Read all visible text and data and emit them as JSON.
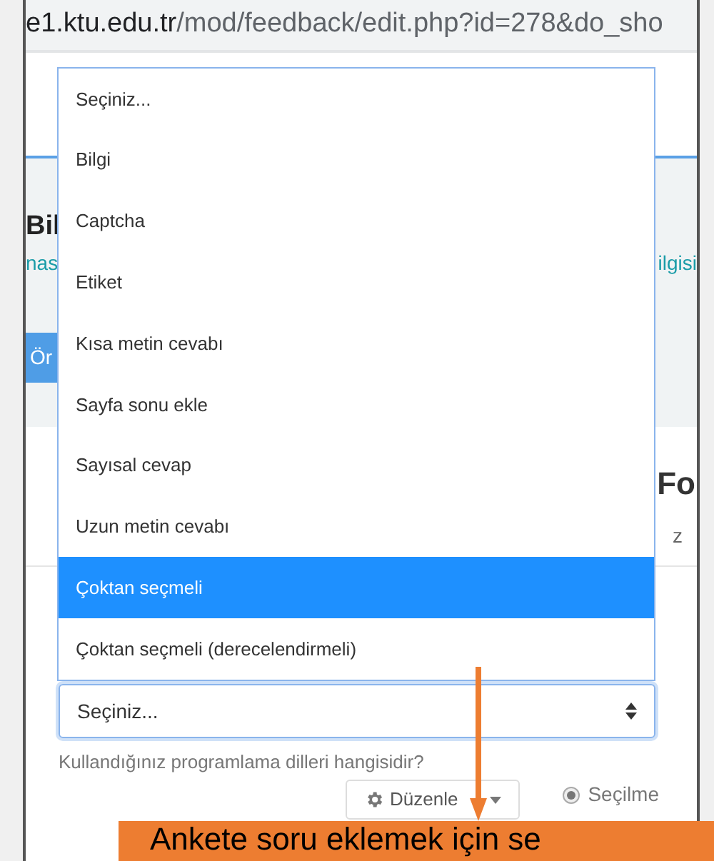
{
  "address_bar": {
    "host": "e1.ktu.edu.tr",
    "path": "/mod/feedback/edit.php?id=278&do_sho"
  },
  "background_page": {
    "heading": "Bil",
    "link_left": "nas",
    "link_right": "ilgisi",
    "button": "Ör",
    "form_heading": "Fo",
    "tab_fragment": "z",
    "question_select": {
      "value": "Seçiniz..."
    },
    "question_text": "Kullandığınız programlama dilleri hangisidir?",
    "edit_button": "Düzenle",
    "radio": {
      "label": "Seçilme",
      "selected": true
    }
  },
  "dropdown": {
    "options": [
      {
        "label": "Seçiniz...",
        "selected": false
      },
      {
        "label": "Bilgi",
        "selected": false
      },
      {
        "label": "Captcha",
        "selected": false
      },
      {
        "label": "Etiket",
        "selected": false
      },
      {
        "label": "Kısa metin cevabı",
        "selected": false
      },
      {
        "label": "Sayfa sonu ekle",
        "selected": false
      },
      {
        "label": "Sayısal cevap",
        "selected": false
      },
      {
        "label": "Uzun metin cevabı",
        "selected": false
      },
      {
        "label": "Çoktan seçmeli",
        "selected": true
      },
      {
        "label": "Çoktan seçmeli (derecelendirmeli)",
        "selected": false
      }
    ]
  },
  "callout": {
    "text": "Ankete soru eklemek için se"
  }
}
